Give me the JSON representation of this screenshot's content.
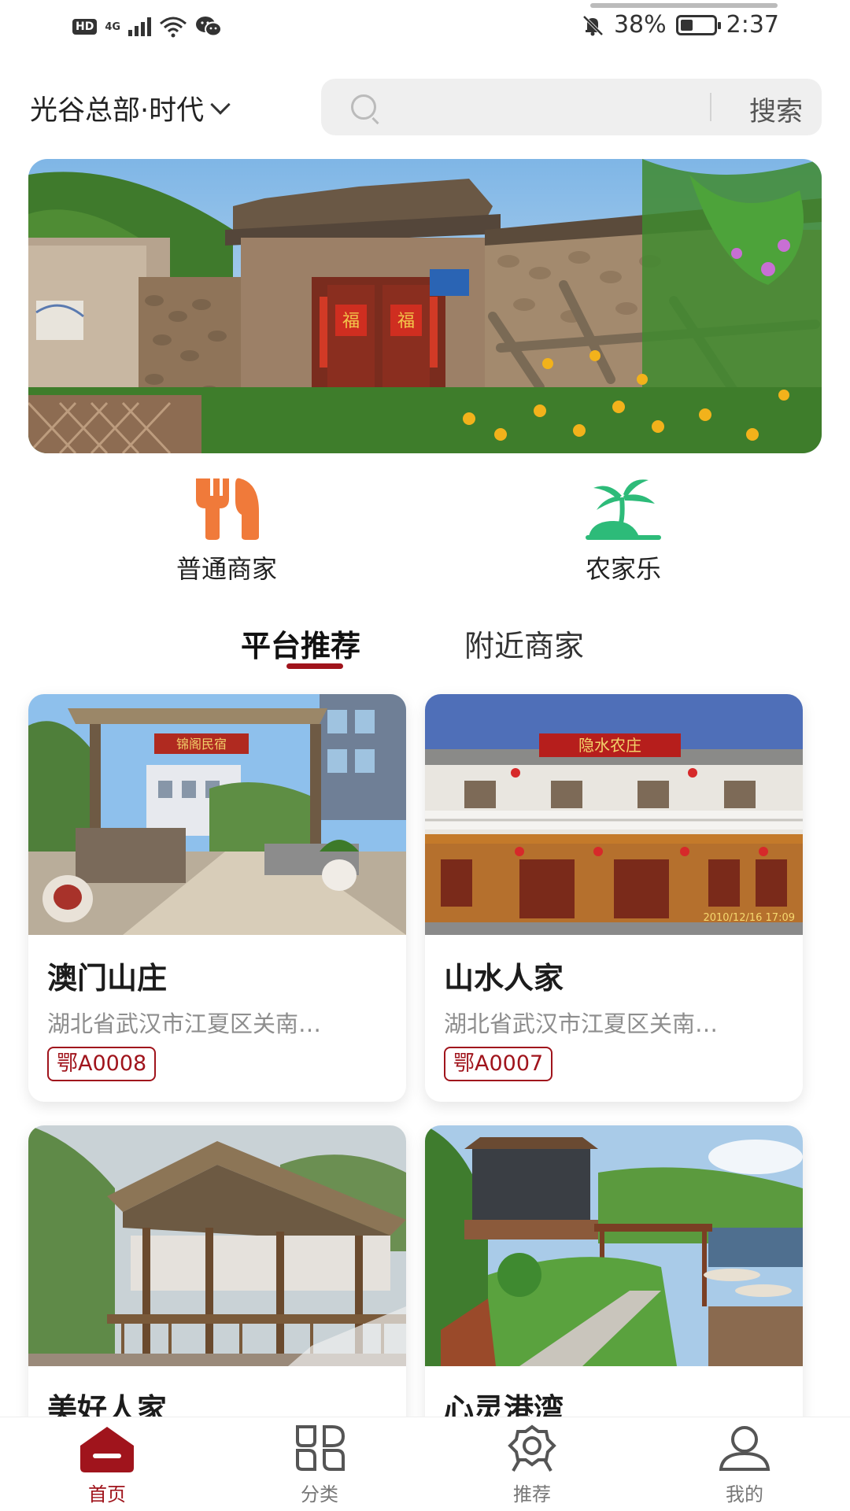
{
  "status_bar": {
    "hd": "HD",
    "network": "4G",
    "battery": "38%",
    "battery_level": 0.38,
    "time": "2:37"
  },
  "header": {
    "location": "光谷总部·时代",
    "search_placeholder": "",
    "search_button": "搜索"
  },
  "categories": [
    {
      "label": "普通商家",
      "icon": "fork-knife-icon",
      "color": "#f07a3a"
    },
    {
      "label": "农家乐",
      "icon": "palm-island-icon",
      "color": "#2dbb79"
    }
  ],
  "tabs": [
    {
      "label": "平台推荐",
      "active": true
    },
    {
      "label": "附近商家",
      "active": false
    }
  ],
  "merchants": [
    {
      "name": "澳门山庄",
      "address": "湖北省武汉市江夏区关南…",
      "code": "鄂A0008"
    },
    {
      "name": "山水人家",
      "address": "湖北省武汉市江夏区关南…",
      "code": "鄂A0007"
    },
    {
      "name": "美好人家"
    },
    {
      "name": "心灵港湾"
    }
  ],
  "photo_texts": {
    "sign1": "锦阁民宿",
    "sign2": "隐水农庄",
    "timestamp": "2010/12/16 17:09"
  },
  "bottom_nav": [
    {
      "label": "首页",
      "icon": "home-icon",
      "active": true
    },
    {
      "label": "分类",
      "icon": "category-icon",
      "active": false
    },
    {
      "label": "推荐",
      "icon": "recommend-icon",
      "active": false
    },
    {
      "label": "我的",
      "icon": "profile-icon",
      "active": false
    }
  ],
  "colors": {
    "accent": "#a0141c",
    "food_orange": "#f07a3a",
    "farm_green": "#2dbb79"
  }
}
